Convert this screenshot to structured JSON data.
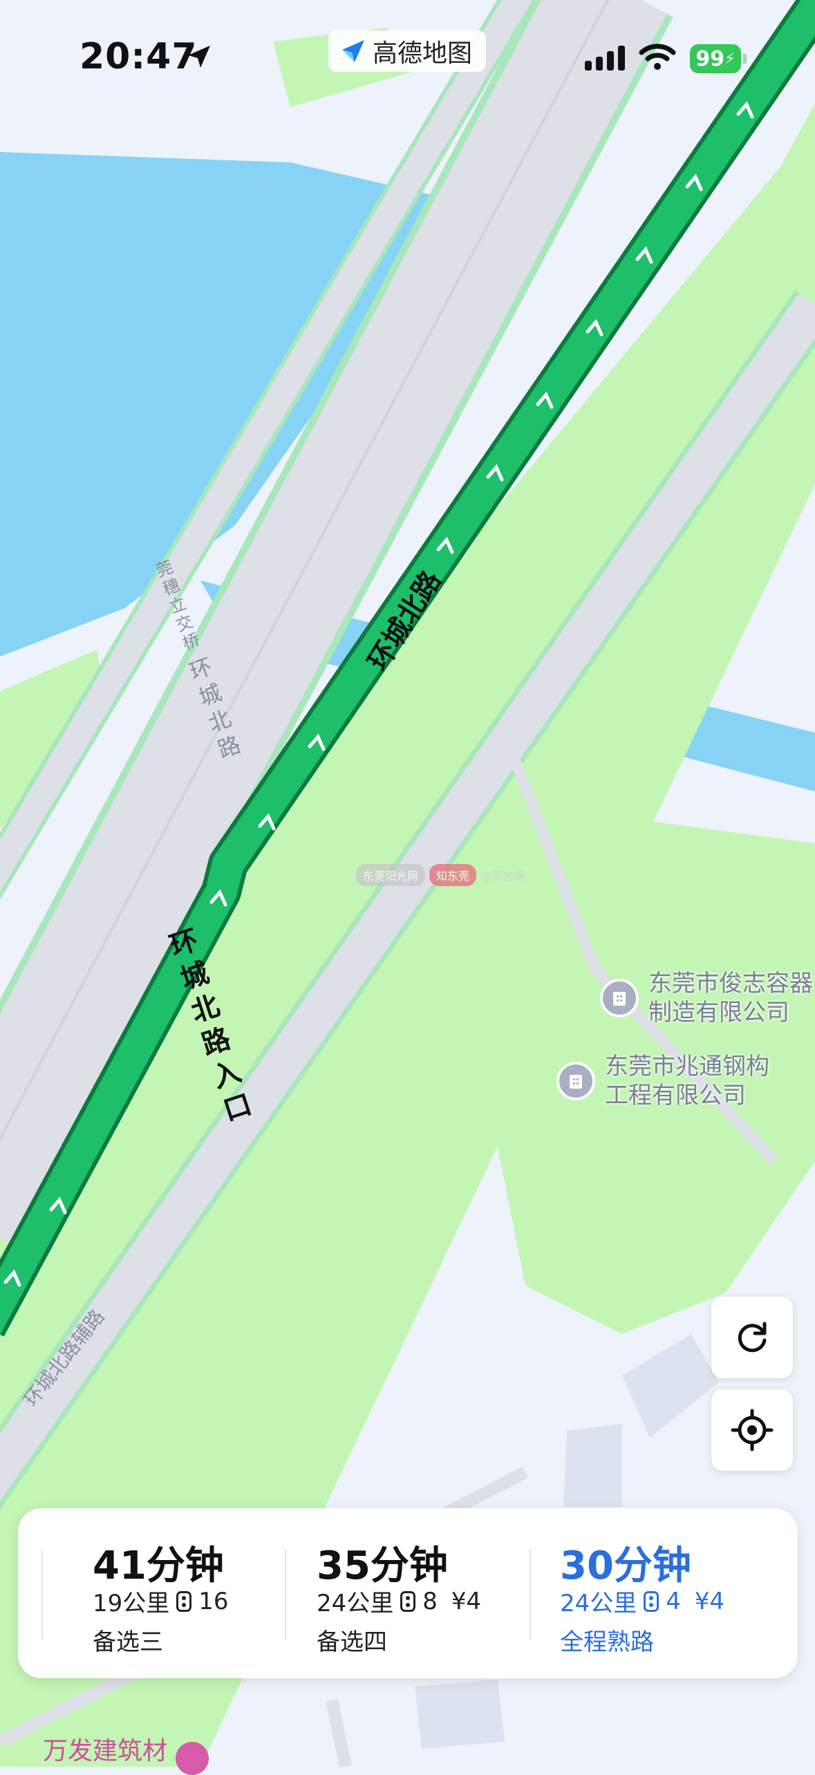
{
  "status_bar": {
    "time": "20:47",
    "app_badge": "高德地图",
    "battery": "99"
  },
  "map": {
    "road_labels": {
      "main_route_upper": "环城北路",
      "main_route_entrance": "环城北路入口",
      "parallel_road": "环城北路",
      "interchange": "莞穗立交桥",
      "aux_road": "环城北路辅路"
    },
    "pois": [
      {
        "line1": "东莞市俊志容器",
        "line2": "制造有限公司",
        "icon": "building-icon"
      },
      {
        "line1": "东莞市兆通钢构",
        "line2": "工程有限公司",
        "icon": "building-icon"
      }
    ],
    "bottom_poi": "万发建筑材",
    "watermark": {
      "a": "东莞阳光网",
      "b": "知东莞",
      "c": "@阳光网"
    }
  },
  "controls": {
    "refresh_icon": "refresh-icon",
    "locate_icon": "locate-icon"
  },
  "routes": [
    {
      "duration": "41分钟",
      "distance": "19公里",
      "lights": "16",
      "toll": "",
      "tag": "备选三",
      "selected": false
    },
    {
      "duration": "35分钟",
      "distance": "24公里",
      "lights": "8",
      "toll": "¥4",
      "tag": "备选四",
      "selected": false
    },
    {
      "duration": "30分钟",
      "distance": "24公里",
      "lights": "4",
      "toll": "¥4",
      "tag": "全程熟路",
      "selected": true
    }
  ],
  "colors": {
    "route_green": "#1dbf6a",
    "route_dark": "#0c7a3e",
    "water": "#86d3f5",
    "park": "#c3f5b4",
    "road": "#dde0e7",
    "selected_blue": "#2a6fdb"
  }
}
